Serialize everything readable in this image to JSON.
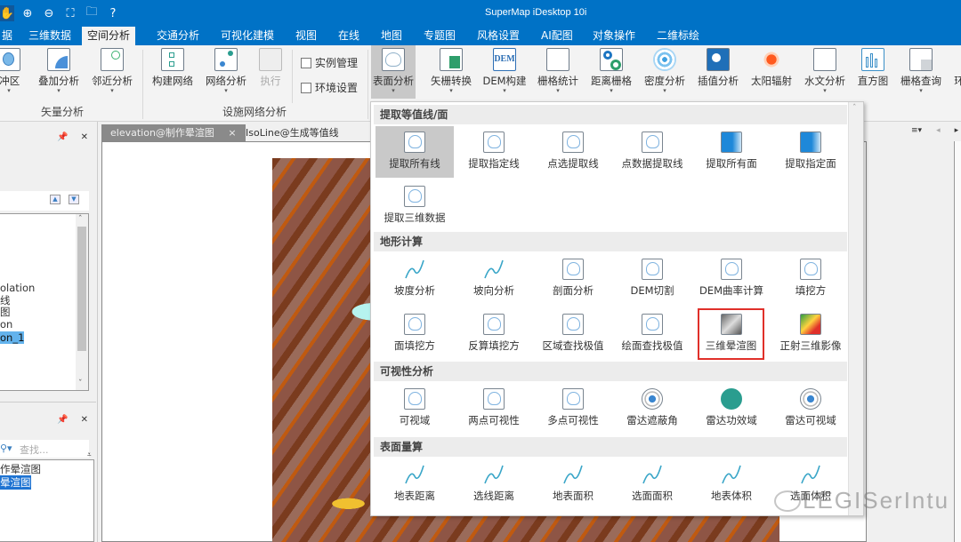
{
  "app_title": "SuperMap iDesktop 10i",
  "quick_access": [
    {
      "icon": "pan-hand-icon"
    },
    {
      "icon": "zoom-in-icon"
    },
    {
      "icon": "zoom-out-icon"
    },
    {
      "icon": "full-extent-icon"
    },
    {
      "icon": "open-folder-icon"
    },
    {
      "icon": "help-icon"
    }
  ],
  "tabs": [
    {
      "label": "据",
      "active": false
    },
    {
      "label": "三维数据",
      "active": false
    },
    {
      "label": "空间分析",
      "active": true
    },
    {
      "label": "交通分析",
      "active": false
    },
    {
      "label": "可视化建模",
      "active": false
    },
    {
      "label": "视图",
      "active": false
    },
    {
      "label": "在线",
      "active": false
    },
    {
      "label": "地图",
      "active": false,
      "contextual": true
    },
    {
      "label": "专题图",
      "active": false,
      "contextual": true
    },
    {
      "label": "风格设置",
      "active": false,
      "contextual": true
    },
    {
      "label": "AI配图",
      "active": false,
      "contextual": true
    },
    {
      "label": "对象操作",
      "active": false,
      "contextual": true
    },
    {
      "label": "二维标绘",
      "active": false,
      "contextual": true
    }
  ],
  "ribbon": {
    "vector_group": {
      "label": "矢量分析",
      "buttons": [
        {
          "label": "缓冲区",
          "visible_text": "缓冲区",
          "dropdown": true
        },
        {
          "label": "叠加分析",
          "dropdown": true
        },
        {
          "label": "邻近分析",
          "dropdown": true
        }
      ]
    },
    "network_group": {
      "label": "设施网络分析",
      "buttons": [
        {
          "label": "构建网络",
          "dropdown": false
        },
        {
          "label": "网络分析",
          "dropdown": true
        },
        {
          "label": "执行",
          "dropdown": false,
          "disabled": true
        }
      ],
      "checkboxes": [
        {
          "label": "实例管理",
          "checked": false
        },
        {
          "label": "环境设置",
          "checked": false
        }
      ]
    },
    "raster_buttons": [
      {
        "label": "表面分析",
        "dropdown": true,
        "active": true
      },
      {
        "label": "矢栅转换",
        "dropdown": true
      },
      {
        "label": "DEM构建",
        "dropdown": true
      },
      {
        "label": "栅格统计",
        "dropdown": true
      },
      {
        "label": "距离栅格",
        "dropdown": true
      },
      {
        "label": "密度分析",
        "dropdown": true
      },
      {
        "label": "插值分析",
        "dropdown": false
      },
      {
        "label": "太阳辐射",
        "dropdown": false
      },
      {
        "label": "水文分析",
        "dropdown": true
      },
      {
        "label": "直方图",
        "dropdown": false
      },
      {
        "label": "栅格查询",
        "dropdown": true
      },
      {
        "label": "环",
        "dropdown": false
      }
    ]
  },
  "left_panel": {
    "list_items": [
      {
        "text": "olation",
        "selected": false
      },
      {
        "text": "线",
        "selected": false
      },
      {
        "text": "图",
        "selected": false
      },
      {
        "text": "on",
        "selected": false
      },
      {
        "text": "on_1",
        "selected": true
      }
    ],
    "layers_search_placeholder": "查找...",
    "layer_items": [
      {
        "text": "作晕渲图",
        "selected": false
      },
      {
        "text": "晕渲图",
        "selected": true
      }
    ]
  },
  "doc_tabs": [
    {
      "label": "elevation@制作晕渲图",
      "active": true,
      "close": "×"
    },
    {
      "label": "IsoLine@生成等值线",
      "active": false
    }
  ],
  "dropdown_menu": {
    "sections": [
      {
        "title": "提取等值线/面",
        "items": [
          {
            "label": "提取所有线",
            "highlighted": true
          },
          {
            "label": "提取指定线"
          },
          {
            "label": "点选提取线"
          },
          {
            "label": "点数据提取线"
          },
          {
            "label": "提取所有面"
          },
          {
            "label": "提取指定面"
          },
          {
            "label": "提取三维数据"
          }
        ]
      },
      {
        "title": "地形计算",
        "items": [
          {
            "label": "坡度分析"
          },
          {
            "label": "坡向分析"
          },
          {
            "label": "剖面分析"
          },
          {
            "label": "DEM切割"
          },
          {
            "label": "DEM曲率计算"
          },
          {
            "label": "填挖方"
          },
          {
            "label": "面填挖方"
          },
          {
            "label": "反算填挖方"
          },
          {
            "label": "区域查找极值"
          },
          {
            "label": "绘面查找极值"
          },
          {
            "label": "三维晕渲图",
            "boxed": true
          },
          {
            "label": "正射三维影像"
          }
        ]
      },
      {
        "title": "可视性分析",
        "items": [
          {
            "label": "可视域"
          },
          {
            "label": "两点可视性"
          },
          {
            "label": "多点可视性"
          },
          {
            "label": "雷达遮蔽角"
          },
          {
            "label": "雷达功效域"
          },
          {
            "label": "雷达可视域"
          }
        ]
      },
      {
        "title": "表面量算",
        "items": [
          {
            "label": "地表距离"
          },
          {
            "label": "选线距离"
          },
          {
            "label": "地表面积"
          },
          {
            "label": "选面面积"
          },
          {
            "label": "地表体积"
          },
          {
            "label": "选面体积"
          }
        ]
      }
    ]
  },
  "watermark": "LEGISerIntu",
  "colors": {
    "title_bar": "#0072c6",
    "contextual_tabs": "#0a5ca8",
    "highlight_box": "#e0302a",
    "selection": "#63b3ed"
  }
}
